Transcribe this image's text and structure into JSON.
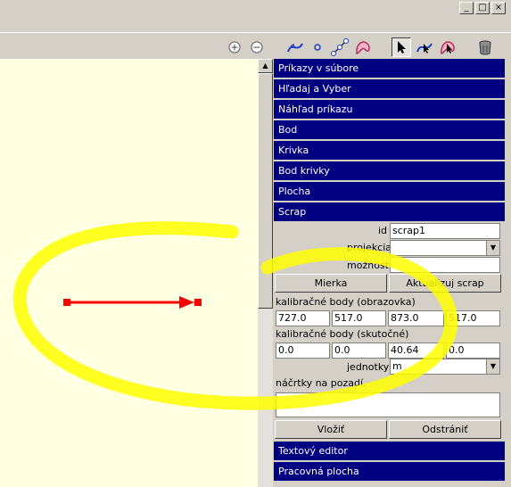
{
  "window": {
    "min_glyph": "_",
    "max_glyph": "□",
    "close_glyph": "×"
  },
  "toolbar": {
    "icons": [
      "zoom-in-icon",
      "zoom-out-icon",
      "curve-tool-icon",
      "point-tool-icon",
      "line-tool-icon",
      "area-tool-icon",
      "select-arrow-icon",
      "select-curve-icon",
      "select-area-icon",
      "delete-trash-icon"
    ],
    "zoom_in_glyph": "+",
    "zoom_out_glyph": "−"
  },
  "scrollbar": {
    "up_glyph": "▲"
  },
  "panel": {
    "sections": [
      "Príkazy v súbore",
      "Hľadaj a Vyber",
      "Náhľad príkazu",
      "Bod",
      "Krivka",
      "Bod krivky",
      "Plocha",
      "Scrap"
    ],
    "scrap": {
      "id_label": "id",
      "id_value": "scrap1",
      "projection_label": "projekcia",
      "projection_value": "",
      "options_label": "možnosti",
      "options_value": "",
      "scale_button": "Mierka",
      "update_button": "Aktualizuj scrap",
      "calib_screen_label": "kalibračné body (obrazovka)",
      "calib_screen_values": [
        "727.0",
        "517.0",
        "873.0",
        "517.0"
      ],
      "calib_real_label": "kalibračné body (skutočné)",
      "calib_real_values": [
        "0.0",
        "0.0",
        "40.64",
        "0.0"
      ],
      "units_label": "jednotky",
      "units_value": "m",
      "sketches_label": "náčrtky na pozadí.",
      "sketches_value": "",
      "insert_button": "Vložiť",
      "remove_button": "Odstrániť"
    },
    "bottom_sections": [
      "Textový editor",
      "Pracovná plocha"
    ]
  },
  "colors": {
    "section_bg": "#000080",
    "canvas_bg": "#ffffe1",
    "scale_bar": "#ff0000",
    "highlight": "#ffff00"
  }
}
